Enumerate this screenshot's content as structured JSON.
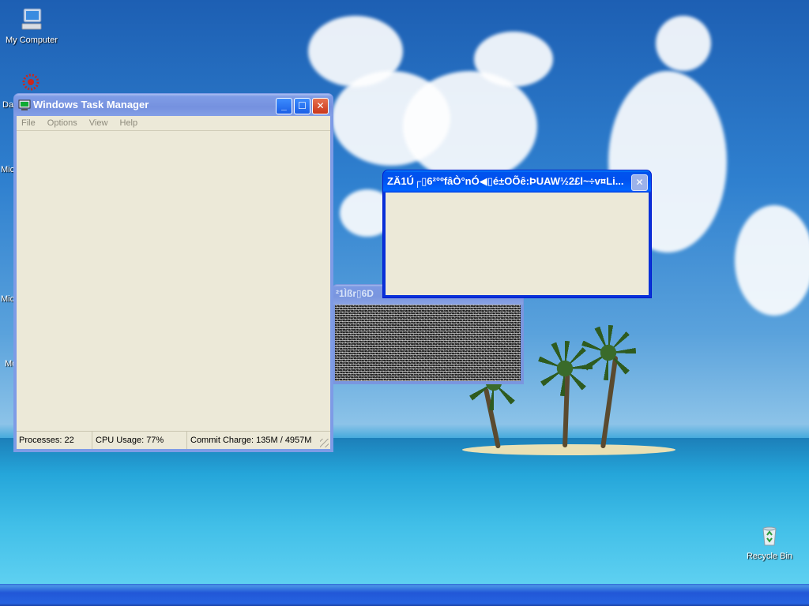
{
  "desktop": {
    "icons": [
      {
        "label": "My Computer"
      },
      {
        "label": "Recycle Bin"
      }
    ],
    "partial_labels": [
      "Da",
      "Mic",
      "Mic",
      "Mo"
    ]
  },
  "task_manager": {
    "title": "Windows Task Manager",
    "menu": [
      "File",
      "Options",
      "View",
      "Help"
    ],
    "status": {
      "processes": "Processes: 22",
      "cpu": "CPU Usage: 77%",
      "commit": "Commit Charge: 135M / 4957M"
    }
  },
  "glitch_window_front": {
    "title": "ZÄ1Ú┌▯6²°ºfâÒ°nÓ◀▯é±OÕê:ÞUAW½2£l~÷v¤Li..."
  },
  "glitch_window_back": {
    "title": "²1Ìßr▯6D"
  }
}
